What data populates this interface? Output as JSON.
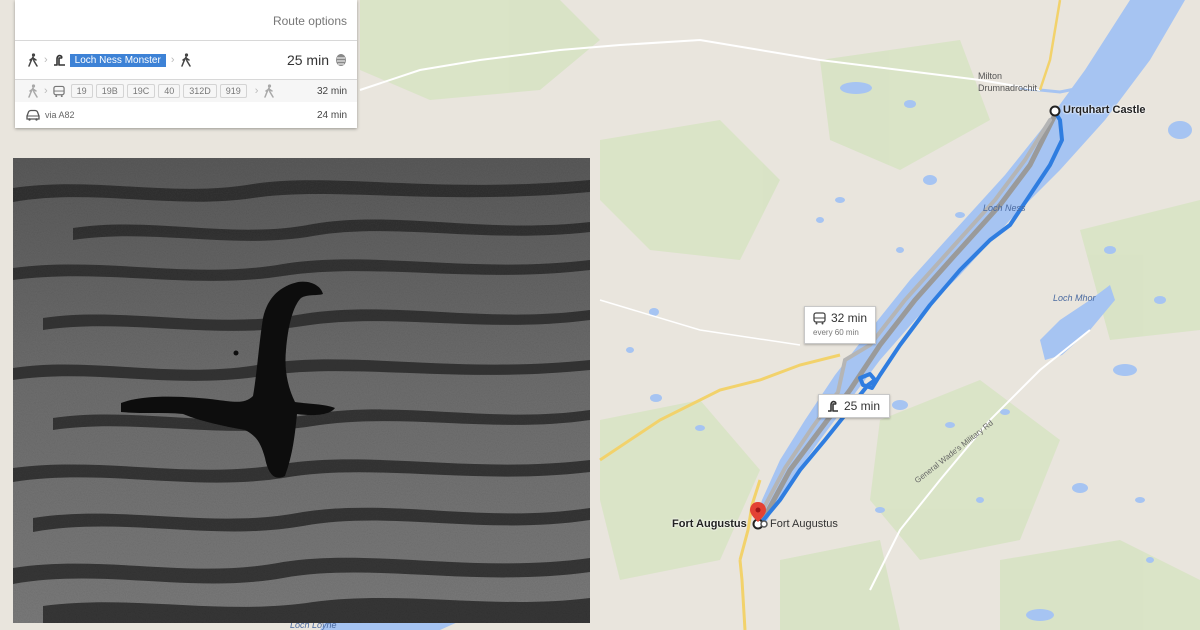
{
  "route_panel": {
    "route_options_label": "Route options",
    "monster_route": {
      "badge_label": "Loch Ness Monster",
      "duration": "25 min"
    },
    "bus_route": {
      "lines": [
        "19",
        "19B",
        "19C",
        "40",
        "312D",
        "919"
      ],
      "duration": "32 min"
    },
    "car_route": {
      "via": "via A82",
      "duration": "24 min"
    }
  },
  "map": {
    "places": {
      "origin": "Urquhart Castle",
      "destination_left": "Fort Augustus",
      "destination_right": "Fort Augustus",
      "milton": "Milton",
      "drumnadrochit": "Drumnadrochit"
    },
    "water_labels": {
      "loch_ness": "Loch Ness",
      "loch_mhor": "Loch Mhor",
      "loch_loyne": "Loch Loyne"
    },
    "road_labels": {
      "military_rd": "General Wade's Military Rd"
    },
    "callouts": {
      "bus": {
        "duration": "32 min",
        "frequency": "every 60 min"
      },
      "monster": {
        "duration": "25 min"
      }
    },
    "colors": {
      "land": "#e8e4dc",
      "water": "#a6c4f2",
      "route": "#2f7de0",
      "alt_route": "#9a9a9a",
      "park": "#d5e2c0"
    }
  },
  "photo": {}
}
